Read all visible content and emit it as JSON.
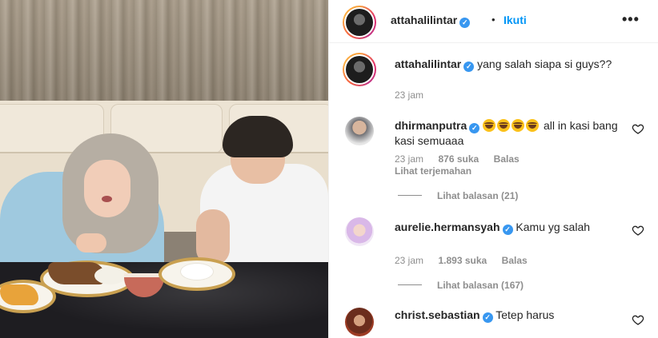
{
  "post": {
    "author": "attahalilintar",
    "follow_label": "Ikuti",
    "separator": "•",
    "more_label": "•••"
  },
  "caption": {
    "username": "attahalilintar",
    "text": "yang salah siapa si guys??",
    "time": "23 jam"
  },
  "comments": [
    {
      "username": "dhirmanputra",
      "text": "all in kasi bang kasi semuaaa",
      "emoji_count": 4,
      "time": "23 jam",
      "likes": "876 suka",
      "reply_label": "Balas",
      "translate_label": "Lihat terjemahan",
      "view_replies": "Lihat balasan (21)"
    },
    {
      "username": "aurelie.hermansyah",
      "text": "Kamu yg salah",
      "time": "23 jam",
      "likes": "1.893 suka",
      "reply_label": "Balas",
      "view_replies": "Lihat balasan (167)"
    },
    {
      "username": "christ.sebastian",
      "text": "Tetep harus"
    }
  ],
  "icons": {
    "verified": "verified-badge-icon",
    "heart": "heart-outline-icon",
    "more": "more-options-icon"
  },
  "colors": {
    "link_blue": "#0095f6",
    "verified_blue": "#3897f0",
    "muted_text": "#8e8e8e",
    "primary_text": "#262626"
  }
}
